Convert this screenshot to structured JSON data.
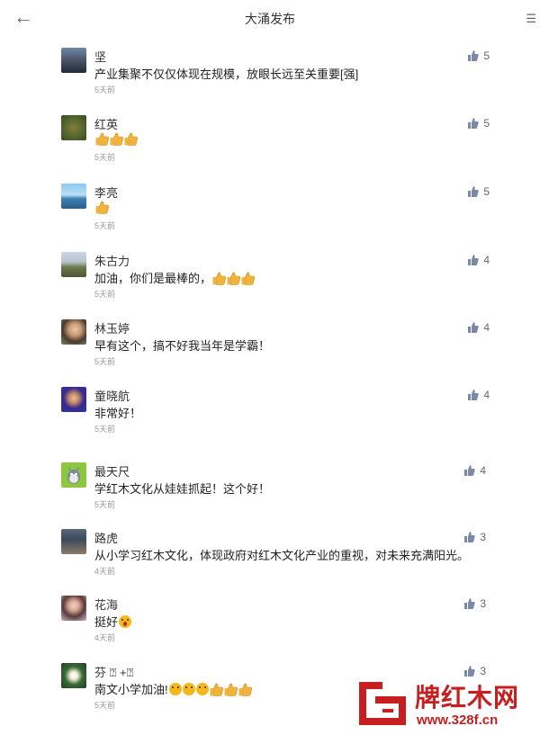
{
  "header": {
    "back_icon": "arrow-left-icon",
    "title": "大涌发布",
    "menu_icon": "menu-icon"
  },
  "colors": {
    "like_icon": "#7a8aa6",
    "thumb_emoji": "#f1b33b",
    "logo_red": "#c5201f"
  },
  "comments": [
    {
      "name": "坚",
      "text": "产业集聚不仅仅体现在规模，放眼长远至关重要[强]",
      "time": "5天前",
      "likes": "5"
    },
    {
      "name": "红英",
      "text": "",
      "emoji": [
        "thumb",
        "thumb",
        "thumb"
      ],
      "time": "5天前",
      "likes": "5"
    },
    {
      "name": "李亮",
      "text": "",
      "emoji": [
        "thumb"
      ],
      "time": "5天前",
      "likes": "5"
    },
    {
      "name": "朱古力",
      "text": "加油，你们是最棒的，",
      "emoji": [
        "thumb",
        "thumb",
        "thumb"
      ],
      "time": "5天前",
      "likes": "4"
    },
    {
      "name": "林玉婷",
      "text": "早有这个，搞不好我当年是学霸！",
      "time": "5天前",
      "likes": "4"
    },
    {
      "name": "童晓航",
      "text": "非常好！",
      "time": "5天前",
      "likes": "4"
    },
    {
      "name": "最天尺",
      "text": "学红木文化从娃娃抓起！这个好！",
      "time": "5天前",
      "likes": "4"
    },
    {
      "name": "路虎",
      "text": "从小学习红木文化，体现政府对红木文化产业的重视，对未来充满阳光。",
      "time": "4天前",
      "likes": "3"
    },
    {
      "name": "花海",
      "text": "挺好",
      "emoji": [
        "wow"
      ],
      "time": "4天前",
      "likes": "3"
    },
    {
      "name": "芬 ⍰ +⍰",
      "text": "南文小学加油!",
      "emoji": [
        "smirk",
        "smirk",
        "smirk",
        "thumb",
        "thumb",
        "thumb"
      ],
      "time": "5天前",
      "likes": "3"
    }
  ],
  "watermark": {
    "brand": "牌红木网",
    "url": "www.328f.cn"
  }
}
